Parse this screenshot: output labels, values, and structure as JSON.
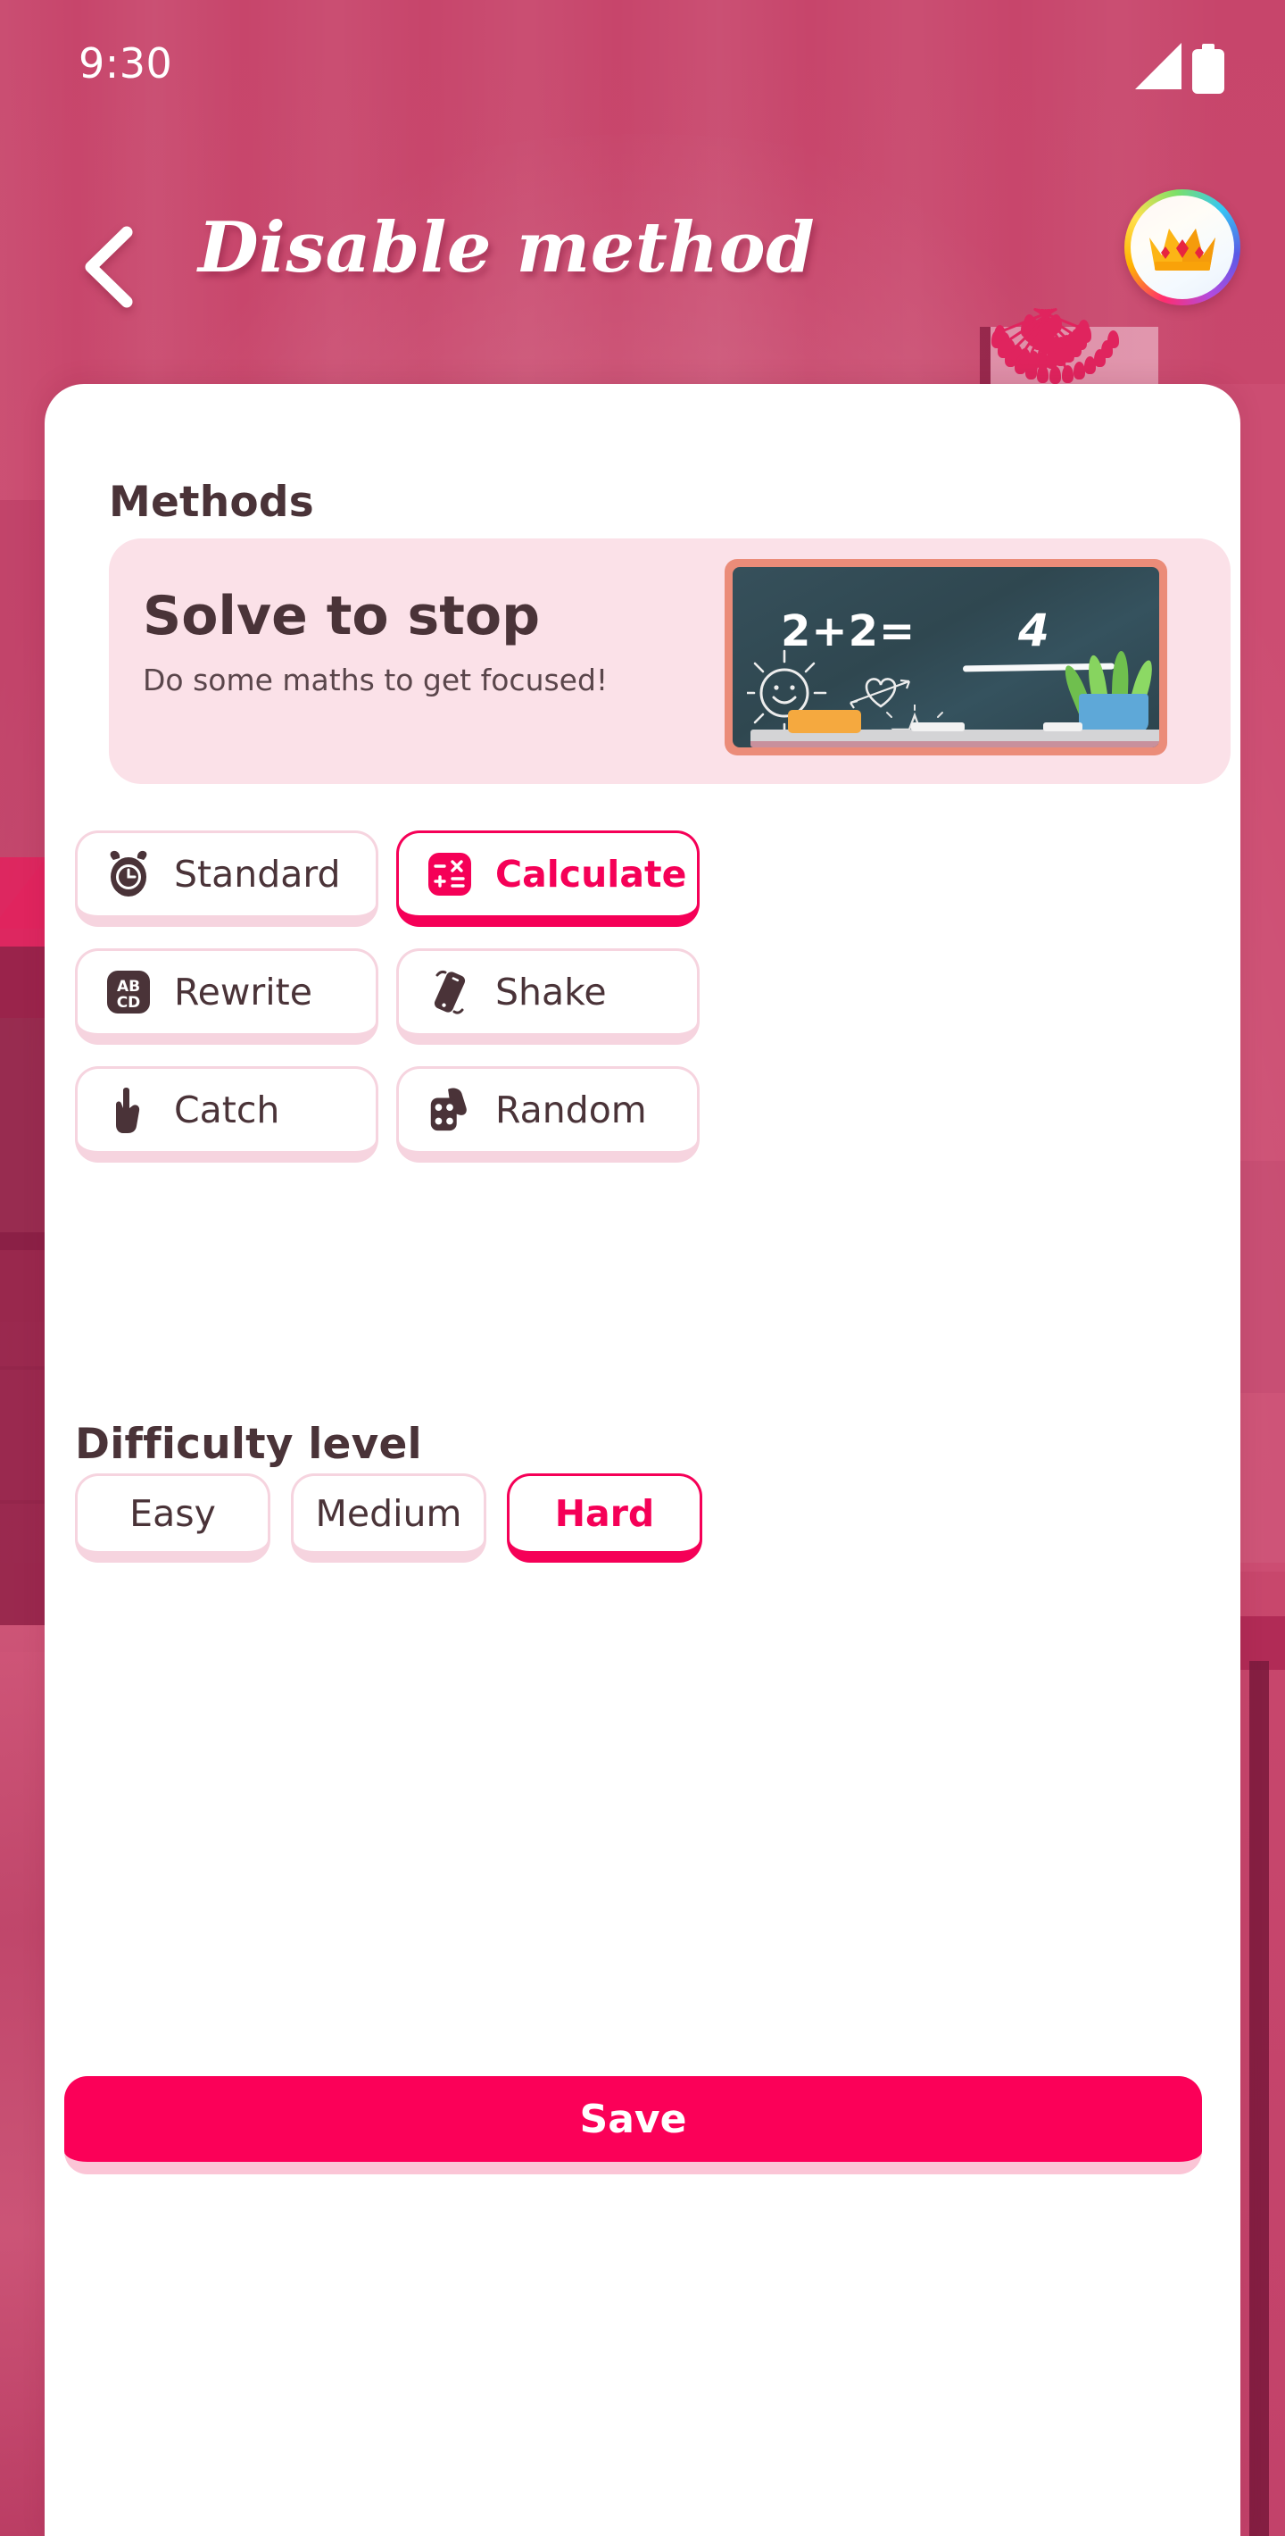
{
  "status_bar": {
    "time": "9:30",
    "icons": [
      "signal-icon",
      "battery-icon"
    ]
  },
  "app_bar": {
    "back_icon": "chevron-left-icon",
    "title": "Disable method",
    "premium_badge_icon": "crown-icon"
  },
  "sheet": {
    "methods_heading": "Methods",
    "difficulty_heading": "Difficulty level"
  },
  "promo": {
    "title": "Solve to stop",
    "subtitle": "Do some maths to get focused!",
    "illustration": {
      "name": "chalkboard-illustration",
      "equation": "2+2=",
      "answer": "4",
      "doodles": [
        "sun-doodle",
        "heart-arrow-doodle",
        "star-doodle"
      ],
      "objects": [
        "eraser",
        "chalk-stick",
        "potted-plant"
      ]
    }
  },
  "methods": [
    {
      "id": "standard",
      "label": "Standard",
      "icon": "alarm-clock-icon",
      "selected": false
    },
    {
      "id": "calculate",
      "label": "Calculate",
      "icon": "calculator-icon",
      "selected": true
    },
    {
      "id": "rewrite",
      "label": "Rewrite",
      "icon": "abcd-keyboard-icon",
      "selected": false
    },
    {
      "id": "shake",
      "label": "Shake",
      "icon": "shake-phone-icon",
      "selected": false
    },
    {
      "id": "catch",
      "label": "Catch",
      "icon": "pointing-hand-icon",
      "selected": false
    },
    {
      "id": "random",
      "label": "Random",
      "icon": "dice-icon",
      "selected": false
    }
  ],
  "difficulty": {
    "options": [
      {
        "id": "easy",
        "label": "Easy",
        "selected": false
      },
      {
        "id": "medium",
        "label": "Medium",
        "selected": false
      },
      {
        "id": "hard",
        "label": "Hard",
        "selected": true
      }
    ]
  },
  "footer": {
    "save_label": "Save"
  },
  "colors": {
    "accent": "#F50057",
    "save_bg": "#FB0058",
    "save_shadow": "#FBC5D6",
    "background_pink": "#C7456B",
    "sheet": "#FFFFFF",
    "promo_bg": "#FBE1E8",
    "border_idle": "#F6D4DF",
    "text_dark": "#4A3338",
    "chalkboard": "#324C56",
    "chalk_frame": "#EB8C79"
  }
}
